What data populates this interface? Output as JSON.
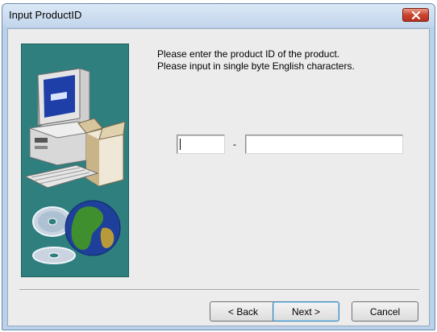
{
  "window": {
    "title": "Input ProductID",
    "close_icon": "close-x-icon"
  },
  "illustration": {
    "icon": "computer-and-globe-illustration"
  },
  "instructions": {
    "line1": "Please enter the product ID of the product.",
    "line2": "Please input in single byte English characters."
  },
  "product_id": {
    "part1_value": "",
    "separator": "-",
    "part2_value": ""
  },
  "buttons": {
    "back": "< Back",
    "next": "Next >",
    "cancel": "Cancel"
  },
  "colors": {
    "art_background": "#2f7f7f",
    "dialog_face": "#ececec",
    "close_button": "#c8452e"
  }
}
